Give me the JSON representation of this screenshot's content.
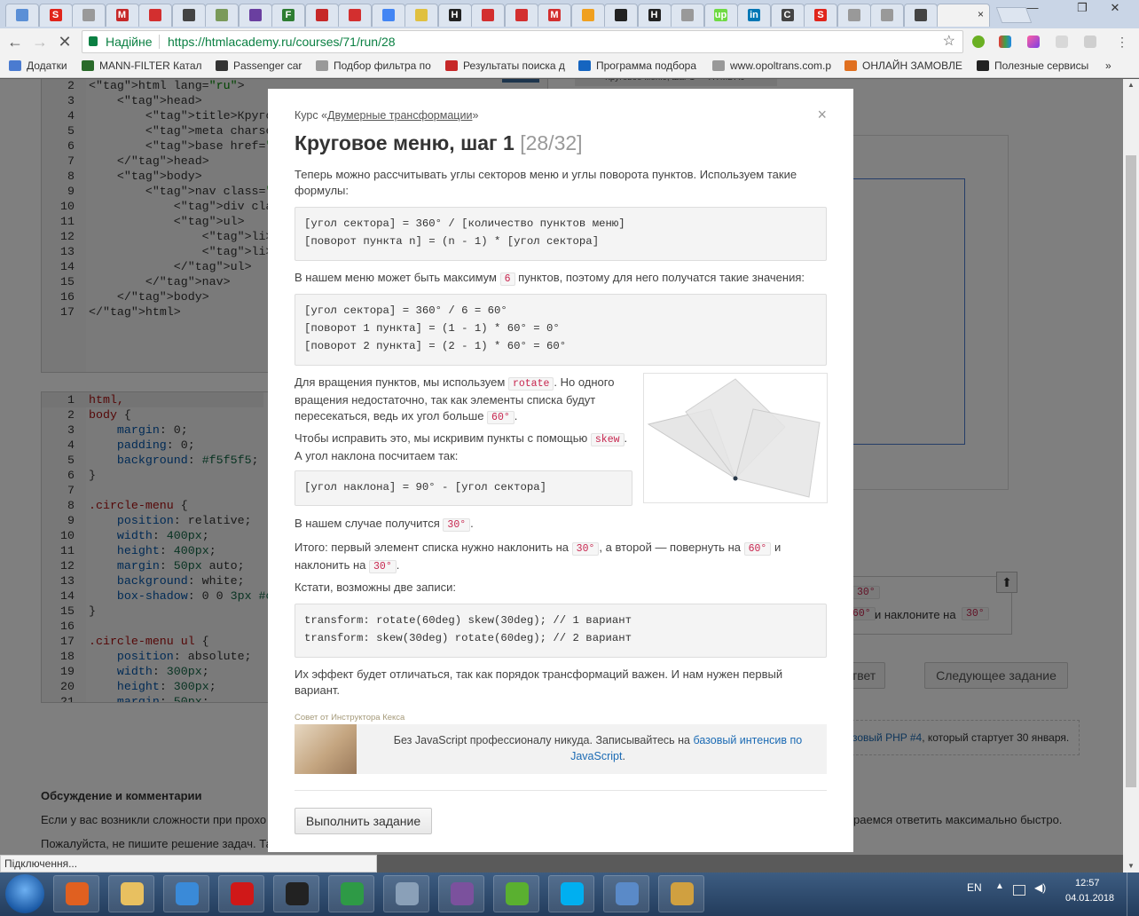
{
  "browser": {
    "tabs": [
      {
        "label": "",
        "icon": "site-icon",
        "color": "#5b8fd6"
      },
      {
        "label": "S",
        "icon": "s-icon",
        "color": "#e0251b"
      },
      {
        "label": "",
        "icon": "doc-icon",
        "color": "#999999"
      },
      {
        "label": "M",
        "icon": "m-icon",
        "color": "#c62828"
      },
      {
        "label": "",
        "icon": "cross-icon",
        "color": "#d32f2f"
      },
      {
        "label": "",
        "icon": "disk-icon",
        "color": "#444444"
      },
      {
        "label": "",
        "icon": "leaf-icon",
        "color": "#7a9a5a"
      },
      {
        "label": "",
        "icon": "square-icon",
        "color": "#6a3fa0"
      },
      {
        "label": "F",
        "icon": "f-icon",
        "color": "#2e7d32"
      },
      {
        "label": "",
        "icon": "thermo-icon",
        "color": "#c62828"
      },
      {
        "label": "",
        "icon": "c-icon",
        "color": "#d32f2f"
      },
      {
        "label": "",
        "icon": "g-icon",
        "color": "#4285f4"
      },
      {
        "label": "",
        "icon": "bulb-icon",
        "color": "#e0c040"
      },
      {
        "label": "H",
        "icon": "h-icon",
        "color": "#222222"
      },
      {
        "label": "",
        "icon": "figure-icon",
        "color": "#d32f2f"
      },
      {
        "label": "",
        "icon": "figure-icon",
        "color": "#d32f2f"
      },
      {
        "label": "M",
        "icon": "gmail-icon",
        "color": "#d32f2f"
      },
      {
        "label": "",
        "icon": "smile-icon",
        "color": "#f0a020"
      },
      {
        "label": "",
        "icon": "terminal-icon",
        "color": "#222222"
      },
      {
        "label": "H",
        "icon": "h-icon",
        "color": "#222222"
      },
      {
        "label": "",
        "icon": "doc-icon",
        "color": "#999999"
      },
      {
        "label": "up",
        "icon": "upwork-icon",
        "color": "#6fda44"
      },
      {
        "label": "in",
        "icon": "linkedin-icon",
        "color": "#0077b5"
      },
      {
        "label": "C",
        "icon": "c-icon",
        "color": "#444444"
      },
      {
        "label": "S",
        "icon": "s-icon",
        "color": "#e0251b"
      },
      {
        "label": "",
        "icon": "doc-icon",
        "color": "#999999"
      },
      {
        "label": "",
        "icon": "doc-icon",
        "color": "#999999"
      },
      {
        "label": "",
        "icon": "shield-icon",
        "color": "#444444"
      }
    ],
    "active_tab_close": "×",
    "window_controls": [
      "—",
      "❐",
      "✕"
    ],
    "security_label": "Надійне",
    "url": "https://htmlacademy.ru/courses/71/run/28",
    "bookmarks": [
      {
        "label": "Додатки",
        "color": "#4a7bd0"
      },
      {
        "label": "MANN-FILTER Катал",
        "color": "#2a6a2a"
      },
      {
        "label": "Passenger car",
        "color": "#333333"
      },
      {
        "label": "Подбор фильтра по",
        "color": "#999999"
      },
      {
        "label": "Результаты поиска д",
        "color": "#c62828"
      },
      {
        "label": "Программа подбора",
        "color": "#1565c0"
      },
      {
        "label": "www.opoltrans.com.p",
        "color": "#999999"
      },
      {
        "label": "ОНЛАЙН ЗАМОВЛЕ",
        "color": "#e07020"
      },
      {
        "label": "Полезные сервисы",
        "color": "#222222"
      }
    ],
    "bookmarks_more": "»",
    "status": "Підключення..."
  },
  "editor_html": {
    "lines": [
      {
        "n": "2",
        "t": "<html lang=\"ru\">"
      },
      {
        "n": "3",
        "t": "    <head>"
      },
      {
        "n": "4",
        "t": "        <title>Круговое мен"
      },
      {
        "n": "5",
        "t": "        <meta charset=\"utf"
      },
      {
        "n": "6",
        "t": "        <base href=\"/asset"
      },
      {
        "n": "7",
        "t": "    </head>"
      },
      {
        "n": "8",
        "t": "    <body>"
      },
      {
        "n": "9",
        "t": "        <nav class=\"circle"
      },
      {
        "n": "10",
        "t": "            <div class=\"cer"
      },
      {
        "n": "11",
        "t": "            <ul>"
      },
      {
        "n": "12",
        "t": "                <li><a hre"
      },
      {
        "n": "13",
        "t": "                <li><a hre"
      },
      {
        "n": "14",
        "t": "            </ul>"
      },
      {
        "n": "15",
        "t": "        </nav>"
      },
      {
        "n": "16",
        "t": "    </body>"
      },
      {
        "n": "17",
        "t": "</html>"
      }
    ]
  },
  "editor_css": {
    "lines": [
      {
        "n": "1",
        "t": "html,"
      },
      {
        "n": "2",
        "t": "body {"
      },
      {
        "n": "3",
        "t": "    margin: 0;"
      },
      {
        "n": "4",
        "t": "    padding: 0;"
      },
      {
        "n": "5",
        "t": "    background: #f5f5f5;"
      },
      {
        "n": "6",
        "t": "}"
      },
      {
        "n": "7",
        "t": ""
      },
      {
        "n": "8",
        "t": ".circle-menu {"
      },
      {
        "n": "9",
        "t": "    position: relative;"
      },
      {
        "n": "10",
        "t": "    width: 400px;"
      },
      {
        "n": "11",
        "t": "    height: 400px;"
      },
      {
        "n": "12",
        "t": "    margin: 50px auto;"
      },
      {
        "n": "13",
        "t": "    background: white;"
      },
      {
        "n": "14",
        "t": "    box-shadow: 0 0 3px #cc"
      },
      {
        "n": "15",
        "t": "}"
      },
      {
        "n": "16",
        "t": ""
      },
      {
        "n": "17",
        "t": ".circle-menu ul {"
      },
      {
        "n": "18",
        "t": "    position: absolute;"
      },
      {
        "n": "19",
        "t": "    width: 300px;"
      },
      {
        "n": "20",
        "t": "    height: 300px;"
      },
      {
        "n": "21",
        "t": "    margin: 50px;"
      }
    ]
  },
  "background_page": {
    "preview_tab": "Круговое меню, шаг 1 — HTML Ac",
    "task_fragment_1": "30°",
    "task_fragment_2_pre": "60°",
    "task_fragment_2_text": "и наклоните на",
    "task_fragment_2_code": "30°",
    "answer_button_partial": "твет",
    "next_task_button": "Следующее задание",
    "promo_link": "зовый PHP #4",
    "promo_text": ", который стартует 30 января.",
    "discussion_title": "Обсуждение и комментарии",
    "discussion_text_1": "Если у вас возникли сложности при прохо",
    "discussion_text_1_end": "раемся ответить максимально быстро.",
    "discussion_text_2": "Пожалуйста, не пишите решение задач. Та"
  },
  "modal": {
    "course_prefix": "Курс «",
    "course_link": "Двумерные трансформации",
    "course_suffix": "»",
    "close": "×",
    "title": "Круговое меню, шаг 1",
    "counter": "[28/32]",
    "p1": "Теперь можно рассчитывать углы секторов меню и углы поворота пунктов. Используем такие формулы:",
    "code1": "[угол сектора] = 360° / [количество пунктов меню]\n[поворот пункта n] = (n - 1) * [угол сектора]",
    "p2_a": "В нашем меню может быть максимум",
    "p2_code": "6",
    "p2_b": "пунктов, поэтому для него получатся такие значения:",
    "code2": "[угол сектора] = 360° / 6 = 60°\n[поворот 1 пункта] = (1 - 1) * 60° = 0°\n[поворот 2 пункта] = (2 - 1) * 60° = 60°",
    "p3_a": "Для вращения пунктов, мы используем",
    "p3_code1": "rotate",
    "p3_b": ". Но одного вращения недостаточно, так как элементы списка будут пересекаться, ведь их угол больше",
    "p3_code2": "60°",
    "p3_c": ".",
    "p4_a": "Чтобы исправить это, мы искривим пункты с помощью",
    "p4_code": "skew",
    "p4_b": ". А угол наклона посчитаем так:",
    "code3": "[угол наклона] = 90° - [угол сектора]",
    "p5_a": "В нашем случае получится",
    "p5_code": "30°",
    "p5_b": ".",
    "p6_a": "Итого: первый элемент списка нужно наклонить на",
    "p6_code1": "30°",
    "p6_b": ", а второй — повернуть на",
    "p6_code2": "60°",
    "p6_c": "и наклонить на",
    "p6_code3": "30°",
    "p6_d": ".",
    "p7": "Кстати, возможны две записи:",
    "code4": "transform: rotate(60deg) skew(30deg); // 1 вариант\ntransform: skew(30deg) rotate(60deg); // 2 вариант",
    "p8": "Их эффект будет отличаться, так как порядок трансформаций важен. И нам нужен первый вариант.",
    "advice_label": "Совет от Инструктора Кекса",
    "advice_text": "Без JavaScript профессионалу никуда. Записывайтесь на",
    "advice_link": "базовый интенсив по JavaScript",
    "advice_end": ".",
    "submit_button": "Выполнить задание"
  },
  "taskbar": {
    "apps": [
      {
        "name": "media-player-icon",
        "color": "#e06020"
      },
      {
        "name": "file-explorer-icon",
        "color": "#e8c060"
      },
      {
        "name": "internet-explorer-icon",
        "color": "#3a8ad8"
      },
      {
        "name": "opera-icon",
        "color": "#d01818"
      },
      {
        "name": "webstorm-icon",
        "color": "#222222"
      },
      {
        "name": "chrome-icon",
        "color": "#2e9a46"
      },
      {
        "name": "calculator-icon",
        "color": "#8aa0b8"
      },
      {
        "name": "viber-icon",
        "color": "#7b519d"
      },
      {
        "name": "icq-icon",
        "color": "#5ab030"
      },
      {
        "name": "skype-icon",
        "color": "#00aff0"
      },
      {
        "name": "network-icon",
        "color": "#5a8ac8"
      },
      {
        "name": "paint-icon",
        "color": "#d0a040"
      }
    ],
    "lang": "EN",
    "time": "12:57",
    "date": "04.01.2018"
  }
}
